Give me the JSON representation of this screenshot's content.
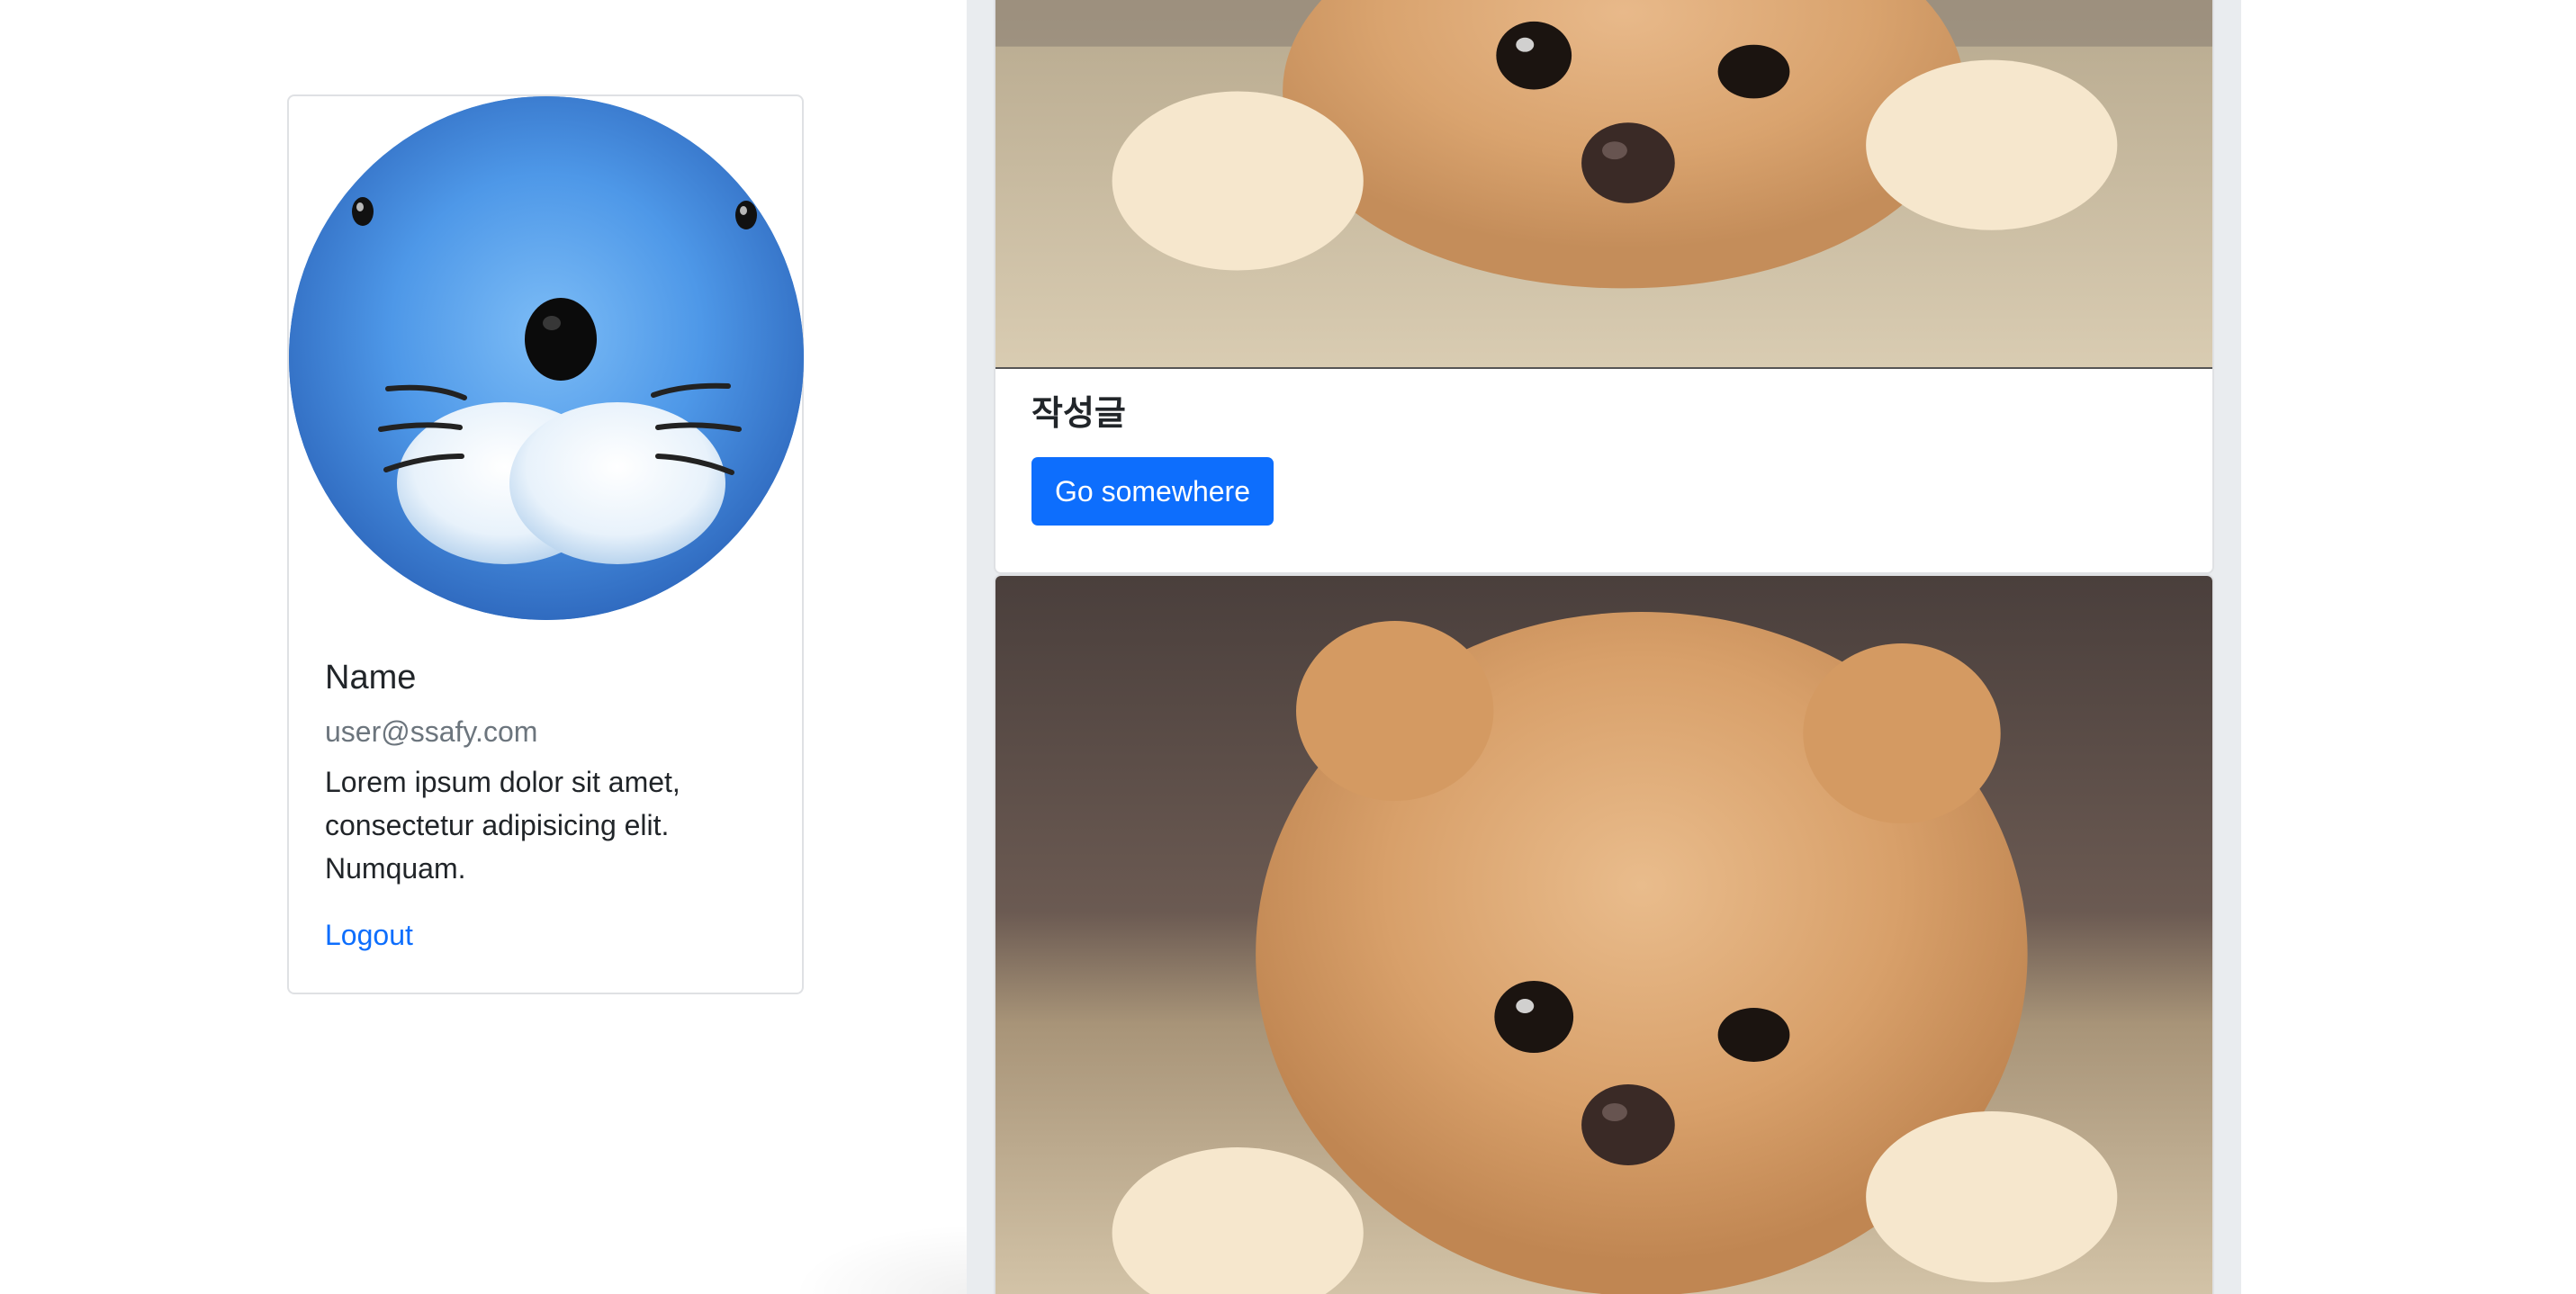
{
  "profile": {
    "avatar_alt": "avatar",
    "name": "Name",
    "email": "user@ssafy.com",
    "bio": "Lorem ipsum dolor sit amet, consectetur adipisicing elit. Numquam.",
    "logout_label": "Logout"
  },
  "feed": {
    "posts": [
      {
        "title": "작성글",
        "button_label": "Go somewhere",
        "image": "pomeranian-photo"
      },
      {
        "image": "pomeranian-photo"
      }
    ]
  },
  "colors": {
    "primary": "#0d6efd",
    "feed_background": "#e9ecef",
    "muted_text": "#6c757d",
    "avatar_blue": "#4a94e6"
  }
}
